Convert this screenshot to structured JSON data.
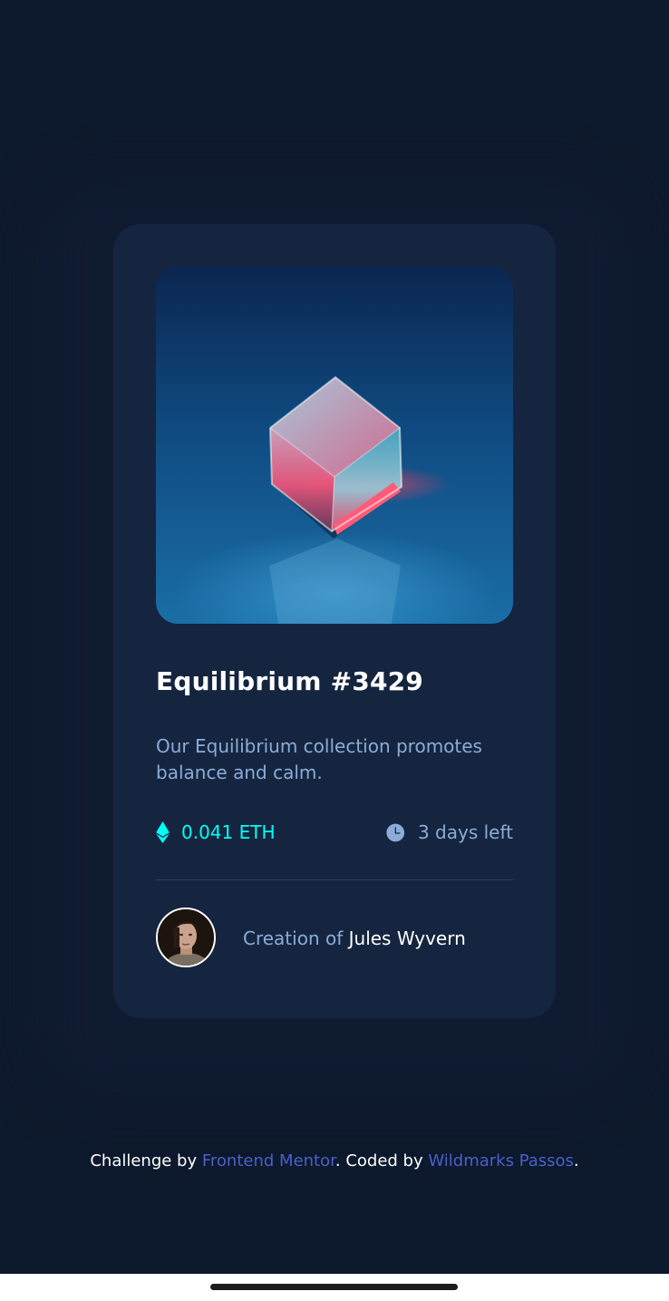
{
  "card": {
    "image_alt": "Equilibrium",
    "title": "Equilibrium #3429",
    "description": "Our Equilibrium collection promotes balance and calm.",
    "price": "0.041 ETH",
    "time_left": "3 days left",
    "creator_prefix": "Creation of",
    "creator_name": "Jules Wyvern",
    "price_icon": "ethereum-icon",
    "time_icon": "clock-icon"
  },
  "footer": {
    "prefix": "Challenge by",
    "link1": "Frontend Mentor",
    "middle": ". Coded by",
    "link2": "Wildmarks Passos",
    "suffix": "."
  },
  "colors": {
    "background": "#0d192c",
    "card": "#15253f",
    "cyan": "#00fff8",
    "soft_blue": "#8bacd9",
    "link": "#4b5fc9",
    "white": "#ffffff"
  }
}
